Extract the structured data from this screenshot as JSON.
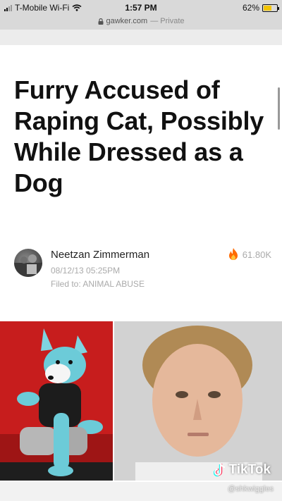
{
  "status_bar": {
    "carrier": "T-Mobile Wi-Fi",
    "time": "1:57 PM",
    "battery": "62%",
    "battery_level": 0.62
  },
  "url_bar": {
    "domain": "gawker.com",
    "mode": "— Private"
  },
  "article": {
    "headline": "Furry Accused of Raping Cat, Possibly While Dressed as a Dog",
    "author": "Neetzan Zimmerman",
    "date": "08/12/13 05:25PM",
    "filed_under": "Filed to: ANIMAL ABUSE",
    "views": "61.80K"
  },
  "watermark": {
    "brand": "TikTok",
    "handle": "@shkwiggles"
  },
  "icons": {
    "wifi": "wifi-icon",
    "lock": "lock-icon",
    "fire": "fire-icon",
    "tiktok": "tiktok-logo-icon"
  },
  "colors": {
    "accent_views": "#ff6a00",
    "photo_bg_left": "#c71d1d"
  }
}
